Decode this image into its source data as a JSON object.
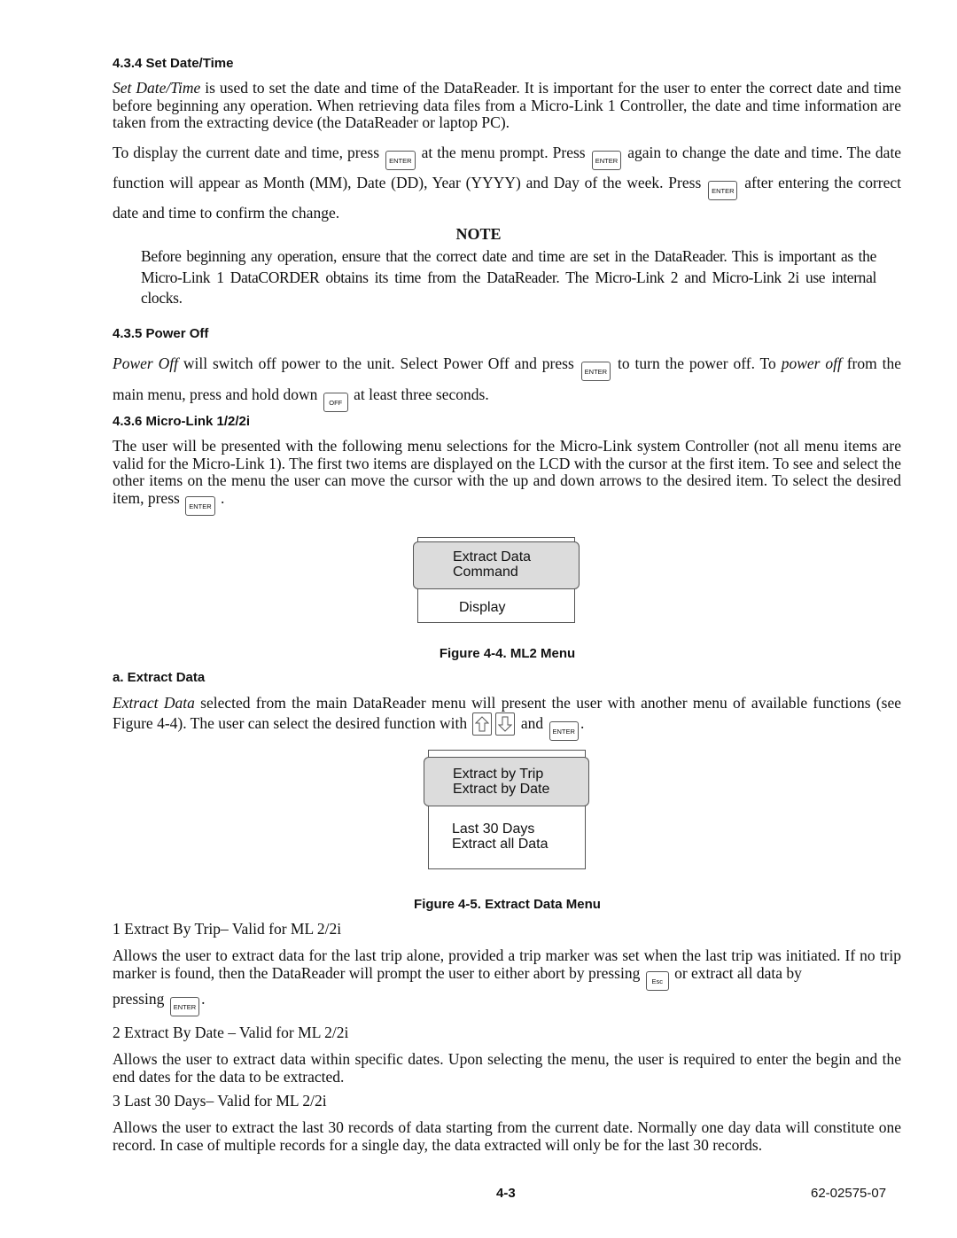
{
  "section_434": {
    "heading": "4.3.4  Set Date/Time",
    "p1_italic": "Set Date/Time",
    "p1_rest": " is used to set the date and time of the DataReader. It is important for the user to enter the correct date and time before beginning any operation. When retrieving data files from a Micro-Link 1 Controller, the date and time information are taken from the extracting device (the DataReader or laptop PC).",
    "p2_a": "To display the current date and time, press",
    "p2_b": "at the menu prompt. Press",
    "p2_c": "again to change the date and time. The date function will appear as Month (MM), Date (DD), Year (YYYY) and Day of the week. Press",
    "p2_d": "after entering the correct date and time to confirm the change."
  },
  "note": {
    "title": "NOTE",
    "text": "Before beginning any operation, ensure that the correct date and time are set in the DataReader. This is important as the Micro-Link 1 DataCORDER obtains its time from the DataReader. The Micro-Link 2 and Micro-Link 2i use internal clocks."
  },
  "section_435": {
    "heading": "4.3.5  Power Off",
    "p_italic1": "Power Off",
    "p_a": " will switch off power to the unit. Select Power Off and press",
    "p_b": "to turn the power off. To",
    "p_italic2": "power off",
    "p_c": "from the main menu, press and hold down",
    "p_d": "at least three seconds."
  },
  "section_436": {
    "heading": "4.3.6  Micro-Link 1/2/2i",
    "p_a": "The user will be presented with the following menu selections for the Micro-Link system Controller (not all menu items are valid for the Micro-Link 1). The first two items are displayed on the LCD with the cursor at the first item. To see and select the other items on the menu the user can move the cursor with the up and down arrows to the desired item. To select the desired item, press",
    "p_b": "."
  },
  "figure_44": {
    "selected_lines": [
      "Extract Data",
      "Command"
    ],
    "other_lines": [
      "Display"
    ],
    "caption": "Figure 4-4. ML2 Menu"
  },
  "section_a": {
    "heading": "a.  Extract Data",
    "p_italic": "Extract Data",
    "p_a": " selected from the main DataReader menu will present the user with another menu of available functions (see Figure 4-4). The user can select the desired function with",
    "p_and": "and",
    "p_end": "."
  },
  "figure_45": {
    "selected_lines": [
      "Extract by Trip",
      "Extract by Date"
    ],
    "other_lines": [
      "Last 30 Days",
      "Extract all Data"
    ],
    "caption": "Figure 4-5. Extract Data Menu"
  },
  "items": [
    {
      "title": "1   Extract By Trip– Valid for ML 2/2i",
      "p_a": "Allows the user to extract data for the last trip alone, provided a trip marker was set when the last trip was initiated. If no trip marker is found, then the DataReader will prompt the user to either abort by pressing",
      "p_b": "or extract all data by",
      "p_c": "pressing",
      "p_d": "."
    },
    {
      "title": "2   Extract By Date – Valid for ML 2/2i",
      "p": "Allows the user to extract data within specific dates. Upon selecting the menu, the user is required to enter the begin and the end dates for the data to be extracted."
    },
    {
      "title": "3   Last 30 Days– Valid for ML 2/2i",
      "p": "Allows the user to extract the last 30 records of data starting from the current date. Normally one day data will constitute one record. In case of multiple records for a single day, the data extracted will only be for the last 30 records."
    }
  ],
  "keys": {
    "enter": "ENTER",
    "off": "OFF",
    "esc": "Esc",
    "up_icon": "up-arrow-key",
    "down_icon": "down-arrow-key"
  },
  "footer": {
    "page": "4-3",
    "doc_number": "62-02575-07"
  }
}
